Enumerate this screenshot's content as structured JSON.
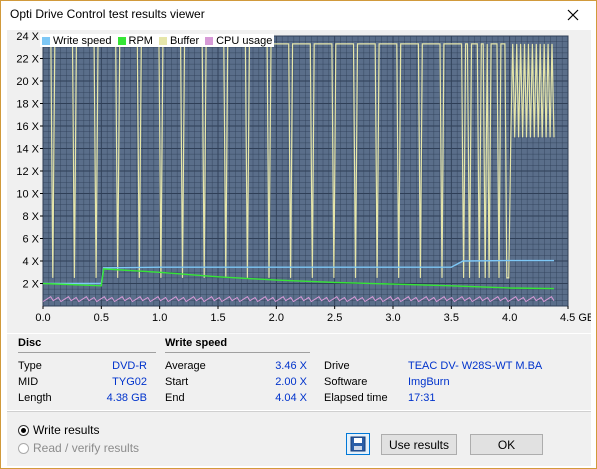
{
  "window": {
    "title": "Opti Drive Control test results viewer"
  },
  "legend": [
    {
      "label": "Write speed",
      "color": "#7ec8f6"
    },
    {
      "label": "RPM",
      "color": "#36e636"
    },
    {
      "label": "Buffer",
      "color": "#e6e6aa"
    },
    {
      "label": "CPU usage",
      "color": "#d79ad7"
    }
  ],
  "chart_data": {
    "type": "line",
    "background": "#5a6e8a",
    "grid": true,
    "x_unit": "GB",
    "xlim": [
      0,
      4.5
    ],
    "ylim": [
      0,
      24
    ],
    "x_ticks": [
      "0.0",
      "0.5",
      "1.0",
      "1.5",
      "2.0",
      "2.5",
      "3.0",
      "3.5",
      "4.0",
      "4.5 GB"
    ],
    "y_ticks": [
      "2 X",
      "4 X",
      "6 X",
      "8 X",
      "10 X",
      "12 X",
      "14 X",
      "16 X",
      "18 X",
      "20 X",
      "22 X",
      "24 X"
    ],
    "series": [
      {
        "name": "Write speed",
        "color": "#7ec8f6",
        "x": [
          0.0,
          0.5,
          0.52,
          1.0,
          1.5,
          2.0,
          2.5,
          3.0,
          3.5,
          3.6,
          4.0,
          4.38
        ],
        "y": [
          2.0,
          2.0,
          3.4,
          3.45,
          3.45,
          3.45,
          3.45,
          3.45,
          3.45,
          4.0,
          4.04,
          4.04
        ]
      },
      {
        "name": "RPM",
        "color": "#36e636",
        "x": [
          0.0,
          0.5,
          0.52,
          1.0,
          1.5,
          2.0,
          2.5,
          3.0,
          3.5,
          4.0,
          4.38
        ],
        "y": [
          2.0,
          1.8,
          3.3,
          3.0,
          2.6,
          2.3,
          2.1,
          1.95,
          1.8,
          1.6,
          1.55
        ]
      },
      {
        "name": "Buffer",
        "color": "#e6e6aa",
        "x": [
          0.0,
          4.38
        ],
        "y": [
          23.3,
          23.3
        ]
      },
      {
        "name": "CPU usage",
        "color": "#d79ad7",
        "x": [
          0.0,
          4.38
        ],
        "y": [
          0.4,
          0.4
        ]
      }
    ]
  },
  "disc": {
    "title": "Disc",
    "rows": [
      {
        "label": "Type",
        "value": "DVD-R"
      },
      {
        "label": "MID",
        "value": "TYG02"
      },
      {
        "label": "Length",
        "value": "4.38 GB"
      }
    ]
  },
  "write_speed": {
    "title": "Write speed",
    "rows": [
      {
        "label": "Average",
        "value": "3.46 X"
      },
      {
        "label": "Start",
        "value": "2.00 X"
      },
      {
        "label": "End",
        "value": "4.04 X"
      }
    ]
  },
  "drive_info": {
    "rows": [
      {
        "label": "Drive",
        "value": "TEAC DV- W28S-WT M.BA"
      },
      {
        "label": "Software",
        "value": "ImgBurn"
      },
      {
        "label": "Elapsed time",
        "value": "17:31"
      }
    ]
  },
  "footer": {
    "radio_write": "Write results",
    "radio_read": "Read / verify results",
    "use_results": "Use results",
    "ok": "OK"
  }
}
